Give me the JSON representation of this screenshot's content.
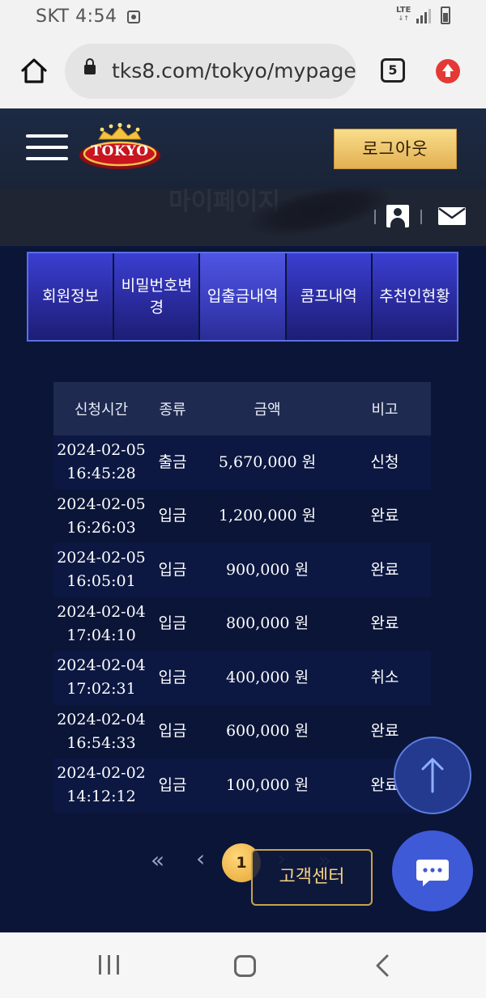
{
  "status_bar": {
    "carrier_time": "SKT 4:54",
    "network": "LTE",
    "network_arrows": "↓↑"
  },
  "browser": {
    "url": "tks8.com/tokyo/mypage",
    "tab_count": "5"
  },
  "header": {
    "logo_text": "TOKYO",
    "logout_label": "로그아웃"
  },
  "subheader": {
    "page_title": "마이페이지"
  },
  "tabs": [
    {
      "label": "회원정보",
      "active": false
    },
    {
      "label": "비밀번호변경",
      "active": false
    },
    {
      "label": "입출금내역",
      "active": true
    },
    {
      "label": "콤프내역",
      "active": false
    },
    {
      "label": "추천인현황",
      "active": false
    }
  ],
  "table": {
    "headers": [
      "신청시간",
      "종류",
      "금액",
      "비고"
    ],
    "rows": [
      {
        "time": "2024-02-05 16:45:28",
        "type": "출금",
        "amount": "5,670,000 원",
        "note": "신청"
      },
      {
        "time": "2024-02-05 16:26:03",
        "type": "입금",
        "amount": "1,200,000 원",
        "note": "완료"
      },
      {
        "time": "2024-02-05 16:05:01",
        "type": "입금",
        "amount": "900,000 원",
        "note": "완료"
      },
      {
        "time": "2024-02-04 17:04:10",
        "type": "입금",
        "amount": "800,000 원",
        "note": "완료"
      },
      {
        "time": "2024-02-04 17:02:31",
        "type": "입금",
        "amount": "400,000 원",
        "note": "취소"
      },
      {
        "time": "2024-02-04 16:54:33",
        "type": "입금",
        "amount": "600,000 원",
        "note": "완료"
      },
      {
        "time": "2024-02-02 14:12:12",
        "type": "입금",
        "amount": "100,000 원",
        "note": "완료"
      }
    ]
  },
  "pagination": {
    "first": "«",
    "prev": "‹",
    "current": "1",
    "next": "›",
    "last": "»"
  },
  "customer_center_label": "고객센터",
  "icons": {
    "home": "home-icon",
    "lock": "lock-icon",
    "update": "update-icon",
    "menu": "hamburger-menu-icon",
    "user": "user-icon",
    "mail": "mail-icon",
    "scroll_top": "arrow-up-icon",
    "chat": "chat-bubble-icon"
  },
  "colors": {
    "page_background": "#0a1538",
    "tab_active": "#3b3fc0",
    "logout_gold": "#e2b052",
    "page_badge": "#e4a534",
    "chat_button": "#3f5ad6"
  }
}
